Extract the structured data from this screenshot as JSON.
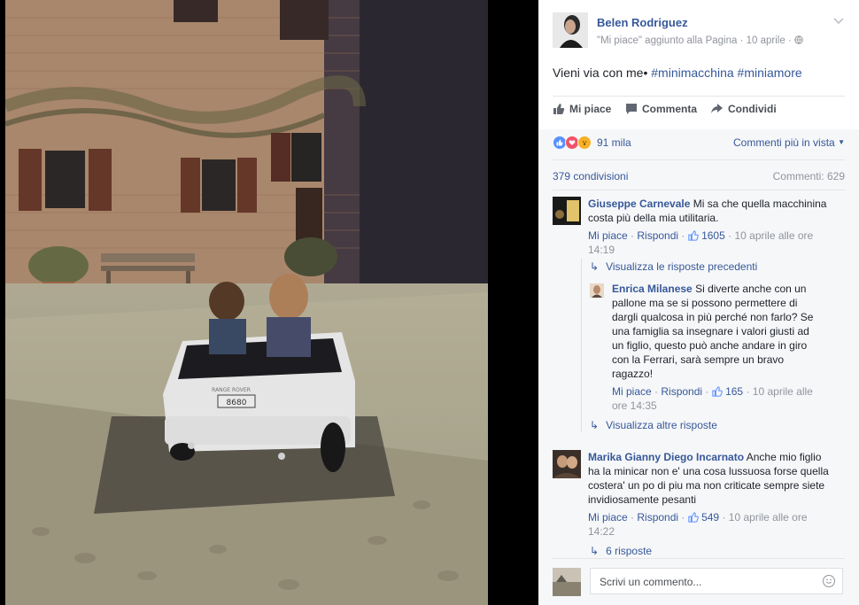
{
  "post": {
    "author": "Belen Rodriguez",
    "meta_activity": "\"Mi piace\" aggiunto alla Pagina",
    "meta_date": "10 aprile",
    "text_plain": "Vieni via con me•",
    "hashtags": [
      "#minimacchina",
      "#miniamore"
    ],
    "photo_plate": "8680",
    "photo_badge": "RANGE ROVER"
  },
  "actions": {
    "like": "Mi piace",
    "comment": "Commenta",
    "share": "Condividi"
  },
  "stats": {
    "reactions_count": "91 mila",
    "sort_label": "Commenti più in vista",
    "shares": "379 condivisioni",
    "comments": "Commenti: 629"
  },
  "comments": [
    {
      "author": "Giuseppe Carnevale",
      "text_line1": "Mi sa che quella macchinina",
      "text_line2": "costa più della mia utilitaria.",
      "like": "Mi piace",
      "reply": "Rispondi",
      "likes": "1605",
      "date_line1": "10 aprile alle ore",
      "date_line2": "14:19",
      "view_previous": "Visualizza le risposte precedenti",
      "reply_item": {
        "author": "Enrica Milanese",
        "lines": [
          "Si diverte anche con un",
          "pallone ma se si possono permettere di",
          "dargli qualcosa in più perché non farlo? Se",
          "una famiglia sa insegnare i valori giusti ad",
          "un figlio, questo può anche andare in giro",
          "con la Ferrari, sarà sempre un bravo",
          "ragazzo!"
        ],
        "like": "Mi piace",
        "reply": "Rispondi",
        "likes": "165",
        "date_line1": "10 aprile alle",
        "date_line2": "ore 14:35"
      },
      "view_more": "Visualizza altre risposte"
    },
    {
      "author": "Marika Gianny Diego Incarnato",
      "lines": [
        "Anche mio figlio",
        "ha la minicar non e' una cosa lussuosa forse quella",
        "costera' un po di piu ma non criticate sempre siete",
        "invidiosamente pesanti"
      ],
      "like": "Mi piace",
      "reply": "Rispondi",
      "likes": "549",
      "date_line1": "10 aprile alle ore",
      "date_line2": "14:22",
      "replies_link": "6 risposte"
    }
  ],
  "composer": {
    "placeholder": "Scrivi un commento..."
  },
  "colors": {
    "link_blue": "#365899",
    "meta_gray": "#90949c",
    "like_blue": "#5890ff",
    "love_red": "#f25268",
    "wow_yellow": "#f7b125"
  },
  "icons": [
    "thumbs-up-icon",
    "comment-icon",
    "share-arrow-icon",
    "globe-icon",
    "chevron-down-icon",
    "like-reaction-icon",
    "love-reaction-icon",
    "wow-reaction-icon",
    "reply-arrow-icon",
    "smiley-icon"
  ]
}
